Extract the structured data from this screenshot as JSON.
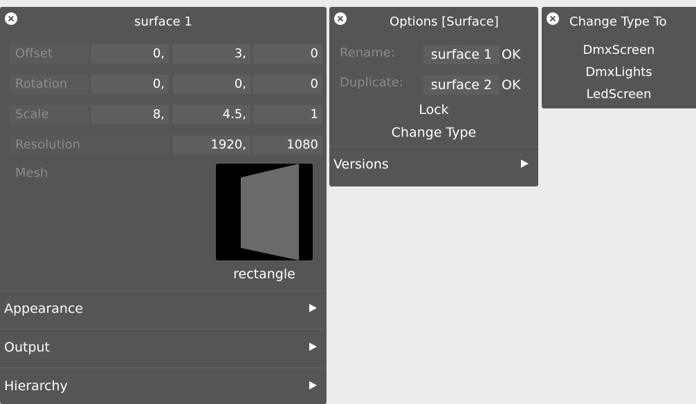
{
  "surface_panel": {
    "title": "surface 1",
    "offset": {
      "label": "Offset",
      "x": "0,",
      "y": "3,",
      "z": "0"
    },
    "rotation": {
      "label": "Rotation",
      "x": "0,",
      "y": "0,",
      "z": "0"
    },
    "scale": {
      "label": "Scale",
      "x": "8,",
      "y": "4.5,",
      "z": "1"
    },
    "resolution": {
      "label": "Resolution",
      "w": "1920,",
      "h": "1080"
    },
    "mesh": {
      "label": "Mesh",
      "name": "rectangle"
    },
    "sections": [
      "Appearance",
      "Output",
      "Hierarchy"
    ]
  },
  "options_panel": {
    "title": "Options [Surface]",
    "rename": {
      "label": "Rename:",
      "value": "surface 1",
      "ok": "OK"
    },
    "duplicate": {
      "label": "Duplicate:",
      "value": "surface 2",
      "ok": "OK"
    },
    "lock": "Lock",
    "change_type": "Change Type",
    "versions": "Versions"
  },
  "change_type_panel": {
    "title": "Change Type To",
    "options": [
      "DmxScreen",
      "DmxLights",
      "LedScreen"
    ]
  },
  "colors": {
    "panel_bg": "#555555",
    "page_bg": "#ececea",
    "dim_label": "#8c8c8c"
  },
  "icons": [
    "close-icon",
    "arrow-right-icon",
    "mesh-thumbnail"
  ]
}
